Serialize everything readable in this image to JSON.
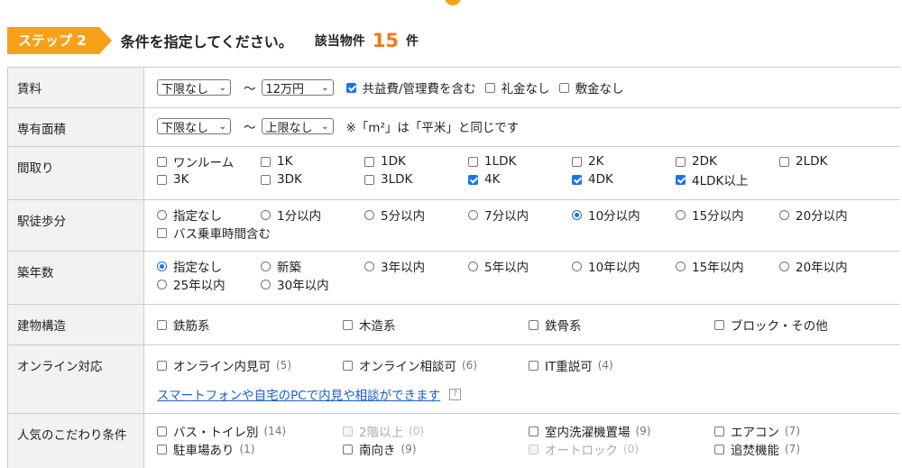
{
  "step": {
    "badge": "ステップ 2",
    "title": "条件を指定してください。",
    "result_label": "該当物件",
    "result_count": "15",
    "result_unit": "件"
  },
  "rent": {
    "label": "賃料",
    "min": "下限なし",
    "tilde": "～",
    "max": "12万円",
    "options": [
      {
        "label": "共益費/管理費を含む",
        "checked": true
      },
      {
        "label": "礼金なし",
        "checked": false
      },
      {
        "label": "敷金なし",
        "checked": false
      }
    ]
  },
  "area": {
    "label": "専有面積",
    "min": "下限なし",
    "tilde": "～",
    "max": "上限なし",
    "note": "※「m²」は「平米」と同じです"
  },
  "layout": {
    "label": "間取り",
    "items": [
      {
        "label": "ワンルーム",
        "checked": false
      },
      {
        "label": "1K",
        "checked": false
      },
      {
        "label": "1DK",
        "checked": false
      },
      {
        "label": "1LDK",
        "checked": false
      },
      {
        "label": "2K",
        "checked": false
      },
      {
        "label": "2DK",
        "checked": false
      },
      {
        "label": "2LDK",
        "checked": false
      },
      {
        "label": "3K",
        "checked": false
      },
      {
        "label": "3DK",
        "checked": false
      },
      {
        "label": "3LDK",
        "checked": false
      },
      {
        "label": "4K",
        "checked": true
      },
      {
        "label": "4DK",
        "checked": true
      },
      {
        "label": "4LDK以上",
        "checked": true
      }
    ]
  },
  "walk": {
    "label": "駅徒歩分",
    "items": [
      {
        "label": "指定なし",
        "checked": false
      },
      {
        "label": "1分以内",
        "checked": false
      },
      {
        "label": "5分以内",
        "checked": false
      },
      {
        "label": "7分以内",
        "checked": false
      },
      {
        "label": "10分以内",
        "checked": true
      },
      {
        "label": "15分以内",
        "checked": false
      },
      {
        "label": "20分以内",
        "checked": false
      }
    ],
    "bus": "バス乗車時間含む"
  },
  "age": {
    "label": "築年数",
    "items": [
      {
        "label": "指定なし",
        "checked": true
      },
      {
        "label": "新築",
        "checked": false
      },
      {
        "label": "3年以内",
        "checked": false
      },
      {
        "label": "5年以内",
        "checked": false
      },
      {
        "label": "10年以内",
        "checked": false
      },
      {
        "label": "15年以内",
        "checked": false
      },
      {
        "label": "20年以内",
        "checked": false
      },
      {
        "label": "25年以内",
        "checked": false
      },
      {
        "label": "30年以内",
        "checked": false
      }
    ]
  },
  "structure": {
    "label": "建物構造",
    "items": [
      "鉄筋系",
      "木造系",
      "鉄骨系",
      "ブロック・その他"
    ]
  },
  "online": {
    "label": "オンライン対応",
    "items": [
      {
        "label": "オンライン内見可",
        "count": "(5)"
      },
      {
        "label": "オンライン相談可",
        "count": "(6)"
      },
      {
        "label": "IT重説可",
        "count": "(4)"
      }
    ],
    "link": "スマートフォンや自宅のPCで内見や相談ができます",
    "help": "?"
  },
  "popular": {
    "label": "人気のこだわり条件",
    "items": [
      {
        "label": "バス・トイレ別",
        "count": "(14)",
        "disabled": false
      },
      {
        "label": "2階以上",
        "count": "(0)",
        "disabled": true
      },
      {
        "label": "室内洗濯機置場",
        "count": "(9)",
        "disabled": false
      },
      {
        "label": "エアコン",
        "count": "(7)",
        "disabled": false
      },
      {
        "label": "駐車場あり",
        "count": "(1)",
        "disabled": false
      },
      {
        "label": "南向き",
        "count": "(9)",
        "disabled": false
      },
      {
        "label": "オートロック",
        "count": "(0)",
        "disabled": true
      },
      {
        "label": "追焚機能",
        "count": "(7)",
        "disabled": false
      }
    ]
  },
  "colors": {
    "accent": "#f7a11a",
    "count": "#f07a14",
    "check": "#1a73e8",
    "link": "#1a5fc9",
    "header_bg": "#f2f2f2"
  }
}
